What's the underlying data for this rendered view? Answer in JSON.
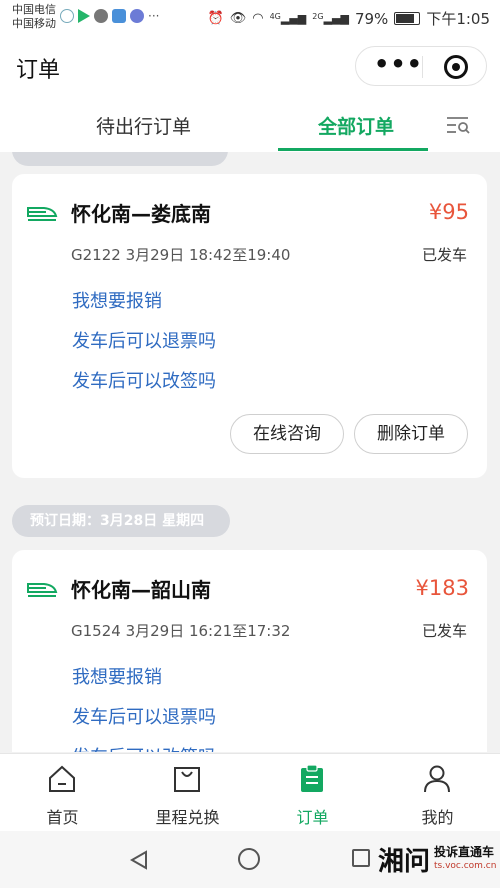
{
  "status_bar": {
    "carrier1": "中国电信",
    "carrier2": "中国移动",
    "network1": "4G",
    "network2": "2G",
    "battery": "79%",
    "time": "下午1:05"
  },
  "header": {
    "title": "订单"
  },
  "tabs": {
    "pending": "待出行订单",
    "all": "全部订单"
  },
  "orders": [
    {
      "route": "怀化南—娄底南",
      "price": "¥95",
      "trip": "G2122   3月29日 18:42至19:40",
      "status": "已发车",
      "links": [
        "我想要报销",
        "发车后可以退票吗",
        "发车后可以改签吗"
      ],
      "buttons": [
        "在线咨询",
        "删除订单"
      ]
    },
    {
      "date_label": "预订日期：3月28日 星期四",
      "route": "怀化南—韶山南",
      "price": "¥183",
      "trip": "G1524   3月29日 16:21至17:32",
      "status": "已发车",
      "links": [
        "我想要报销",
        "发车后可以退票吗",
        "发车后可以改签吗"
      ]
    }
  ],
  "tab_bar": [
    {
      "label": "首页",
      "icon": "home-icon"
    },
    {
      "label": "里程兑换",
      "icon": "shopping-bag-icon"
    },
    {
      "label": "订单",
      "icon": "clipboard-icon"
    },
    {
      "label": "我的",
      "icon": "user-icon"
    }
  ],
  "watermark": {
    "big": "湘问",
    "text": "投诉直通车",
    "sub": "ts.voc.com.cn"
  },
  "colors": {
    "accent": "#13a861",
    "price": "#e8553b",
    "link": "#2f6bc1"
  }
}
